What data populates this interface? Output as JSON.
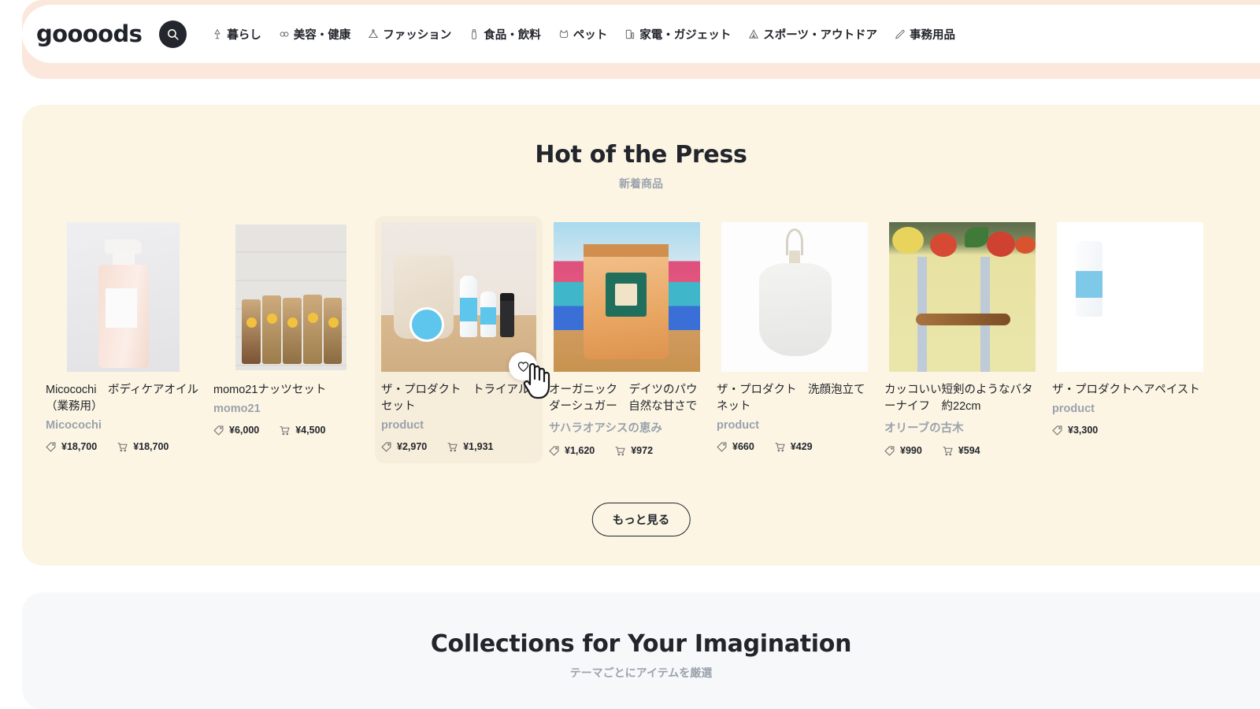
{
  "header": {
    "logo": "goooods",
    "search_icon": "search-icon",
    "nav": [
      {
        "label": "暮らし",
        "icon": "lamp-icon"
      },
      {
        "label": "美容・健康",
        "icon": "lipstick-icon"
      },
      {
        "label": "ファッション",
        "icon": "hanger-icon"
      },
      {
        "label": "食品・飲料",
        "icon": "bottle-icon"
      },
      {
        "label": "ペット",
        "icon": "pet-icon"
      },
      {
        "label": "家電・ガジェット",
        "icon": "device-icon"
      },
      {
        "label": "スポーツ・アウトドア",
        "icon": "tent-icon"
      },
      {
        "label": "事務用品",
        "icon": "pen-icon"
      }
    ]
  },
  "new_arrivals": {
    "title": "Hot of the Press",
    "subtitle": "新着商品",
    "more_label": "もっと見る",
    "favorite_icon": "heart-icon",
    "list_price_icon": "tag-icon",
    "sale_price_icon": "cart-icon",
    "products": [
      {
        "title": "Micocochi　ボディケアオイル（業務用）",
        "shop": "Micocochi",
        "list_price": "¥18,700",
        "sale_price": "¥18,700",
        "image": "body-care-oil-bottle"
      },
      {
        "title": "momo21ナッツセット",
        "shop": "momo21",
        "list_price": "¥6,000",
        "sale_price": "¥4,500",
        "image": "nuts-packets"
      },
      {
        "title": "ザ・プロダクト　トライアルセット",
        "shop": "product",
        "list_price": "¥2,970",
        "sale_price": "¥1,931",
        "image": "trial-set-pouch"
      },
      {
        "title": "オーガニック　デイツのパウダーシュガー　自然な甘さで栄養補…",
        "shop": "サハラオアシスの恵み",
        "list_price": "¥1,620",
        "sale_price": "¥972",
        "image": "dates-powder-pouch"
      },
      {
        "title": "ザ・プロダクト　洗顔泡立てネット",
        "shop": "product",
        "list_price": "¥660",
        "sale_price": "¥429",
        "image": "foaming-net"
      },
      {
        "title": "カッコいい短剣のようなバターナイフ　約22cm",
        "shop": "オリーブの古木",
        "list_price": "¥990",
        "sale_price": "¥594",
        "image": "butter-knife-wood"
      },
      {
        "title": "ザ・プロダクトヘアペイスト",
        "shop": "product",
        "list_price": "¥3,300",
        "sale_price": "",
        "image": "hair-paste-tube"
      }
    ]
  },
  "collections": {
    "title": "Collections for Your Imagination",
    "subtitle": "テーマごとにアイテムを厳選"
  },
  "colors": {
    "header_band": "#fbe7db",
    "new_section_bg": "#fcf5e4",
    "collections_bg": "#f7f8fa",
    "text": "#22252b",
    "muted": "#9aa2ac"
  }
}
